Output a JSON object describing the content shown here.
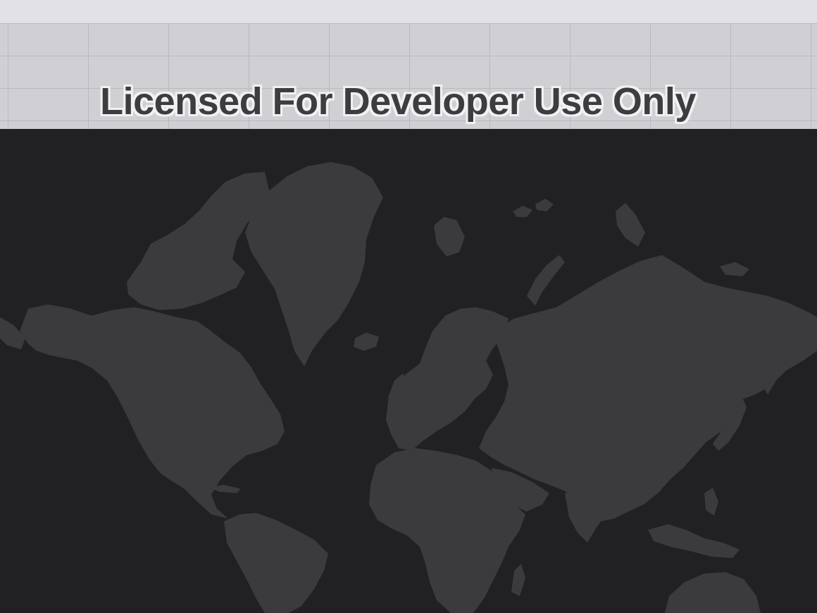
{
  "watermark": {
    "text": "Licensed For Developer Use Only"
  },
  "map": {
    "style": "dark world basemap",
    "ocean_color": "#212124",
    "land_color": "#3b3b3e",
    "grid_band_color": "#d0cfd3"
  }
}
